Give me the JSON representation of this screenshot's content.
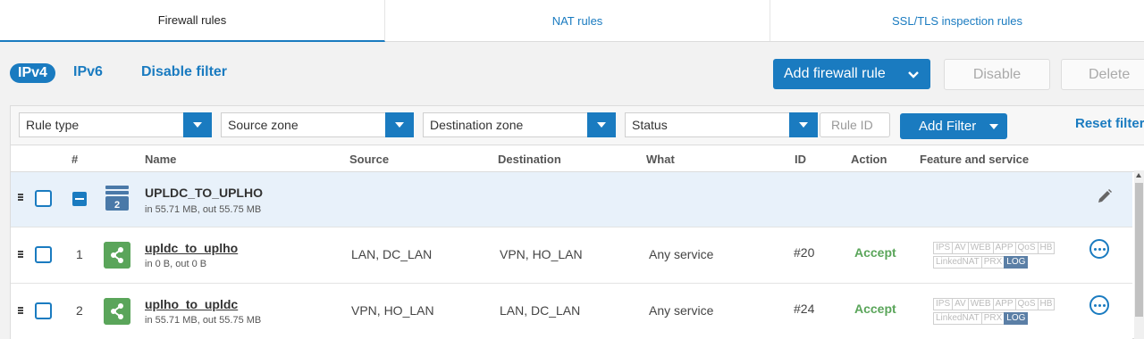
{
  "tabs": [
    {
      "label": "Firewall rules",
      "active": true
    },
    {
      "label": "NAT rules",
      "active": false
    },
    {
      "label": "SSL/TLS inspection rules",
      "active": false
    }
  ],
  "filter_mode": {
    "ipv4": "IPv4",
    "ipv6": "IPv6",
    "disable_filter": "Disable filter"
  },
  "actions": {
    "add_rule": "Add firewall rule",
    "disable": "Disable",
    "delete": "Delete"
  },
  "filters": {
    "rule_type": "Rule type",
    "source_zone": "Source zone",
    "destination_zone": "Destination zone",
    "status": "Status",
    "rule_id_placeholder": "Rule ID",
    "add_filter": "Add Filter",
    "reset_filter": "Reset filter"
  },
  "columns": {
    "num": "#",
    "name": "Name",
    "source": "Source",
    "destination": "Destination",
    "what": "What",
    "id": "ID",
    "action": "Action",
    "feature": "Feature and service"
  },
  "group": {
    "name": "UPLDC_TO_UPLHO",
    "stats": "in 55.71 MB, out 55.75 MB",
    "count": "2"
  },
  "rules": [
    {
      "num": "1",
      "name": "upldc_to_uplho",
      "stats": "in 0 B, out 0 B",
      "source": "LAN, DC_LAN",
      "destination": "VPN, HO_LAN",
      "what": "Any service",
      "id": "#20",
      "action": "Accept"
    },
    {
      "num": "2",
      "name": "uplho_to_upldc",
      "stats": "in 55.71 MB, out 55.75 MB",
      "source": "VPN, HO_LAN",
      "destination": "LAN, DC_LAN",
      "what": "Any service",
      "id": "#24",
      "action": "Accept"
    }
  ],
  "feature_badges": [
    "IPS",
    "AV",
    "WEB",
    "APP",
    "QoS",
    "HB",
    "LinkedNAT",
    "PRX",
    "LOG"
  ],
  "colors": {
    "accent": "#1a7bc0",
    "accept": "#5aa55a",
    "group_bg": "#e8f1fa"
  }
}
